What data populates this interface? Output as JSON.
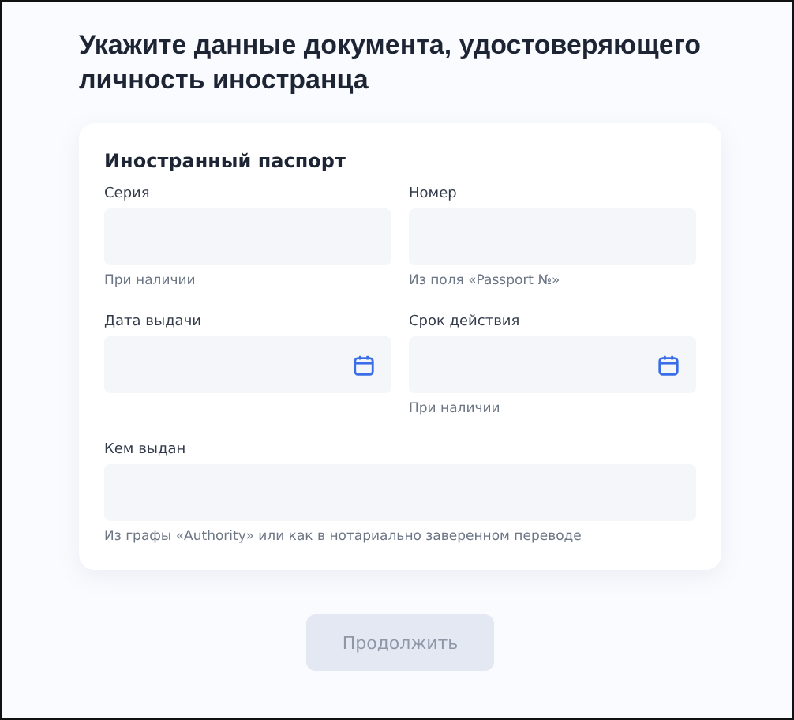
{
  "title": "Укажите данные документа, удостоверяющего личность иностранца",
  "card": {
    "heading": "Иностранный паспорт",
    "fields": [
      {
        "label": "Серия",
        "kind": "text",
        "hint": "При наличии",
        "wide": false
      },
      {
        "label": "Номер",
        "kind": "text",
        "hint": "Из поля «Passport №»",
        "wide": false
      },
      {
        "label": "Дата выдачи",
        "kind": "date",
        "wide": false
      },
      {
        "label": "Срок действия",
        "kind": "date",
        "hint": "При наличии",
        "wide": false
      },
      {
        "label": "Кем выдан",
        "kind": "text",
        "hint": "Из графы «Authority» или как в нотариально заверенном переводе",
        "wide": true
      }
    ]
  },
  "button": {
    "label": "Продолжить",
    "disabled": true
  }
}
